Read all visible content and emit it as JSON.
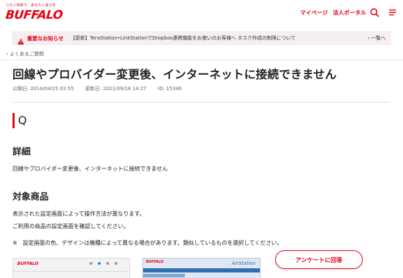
{
  "header": {
    "tagline": "つなぐ技術で、あなたに喜びを",
    "brand": "BUFFALO",
    "my_page": "マイページ",
    "corporate_portal": "法人ポータル",
    "search_icon": "search-icon",
    "menu_icon": "menu-icon"
  },
  "notice": {
    "icon": "warning-icon",
    "label": "重要なお知らせ",
    "text": "【更新】TeraStation•LinkStationでDropbox連携機能をお使いのお客様へ タスク作成の制限について",
    "list_link": "一覧へ"
  },
  "breadcrumb": {
    "label": "よくあるご質問"
  },
  "article": {
    "title": "回線やプロバイダー変更後、インターネットに接続できません",
    "published": "公開日: 2014/04/25 02:55",
    "updated": "更新日: 2021/09/16 14:27",
    "id": "ID: 15346",
    "q_label": "Q",
    "detail_heading": "詳細",
    "detail_text": "回線やプロバイダー変更後、インターネットに接続できません",
    "products_heading": "対象商品",
    "products_text1": "表示された設定画面によって操作方法が異なります。",
    "products_text2": "ご利用の商品の設定画面を確認してください。",
    "note": "※　設定画面の色、デザインは機種によって異なる場合があります。類似しているものを選択してください。"
  },
  "thumbnails": {
    "thumb1_brand": "BUFFALO",
    "thumb2_brand": "BUFFALO",
    "thumb2_product": "AirStation"
  },
  "survey_button": "アンケートに回答",
  "colors": {
    "accent": "#e60012",
    "notice_bg": "#f6eef1"
  }
}
